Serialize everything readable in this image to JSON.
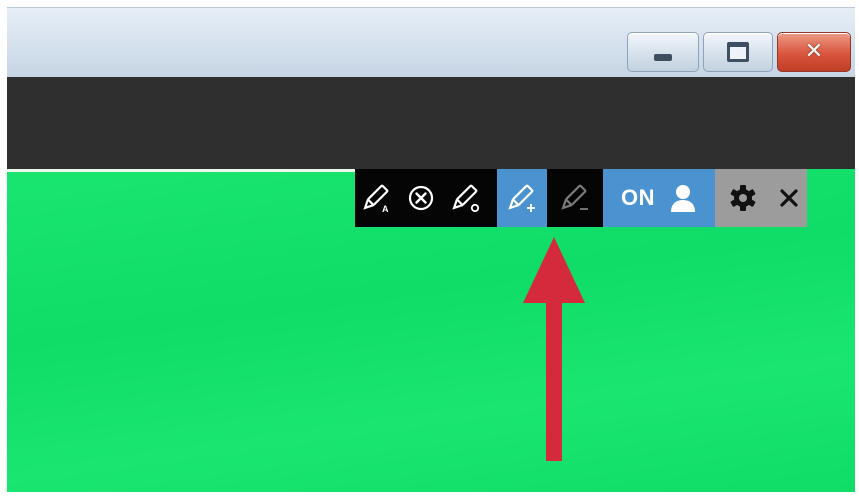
{
  "window": {
    "controls": [
      {
        "name": "minimize",
        "icon": "minimize-icon"
      },
      {
        "name": "maximize",
        "icon": "maximize-icon"
      },
      {
        "name": "close",
        "icon": "close-icon",
        "glyph": "✕"
      }
    ]
  },
  "toolbar": {
    "buttons": [
      {
        "icon": "pencil-a-icon",
        "theme": "dark"
      },
      {
        "icon": "circle-x-icon",
        "theme": "dark"
      },
      {
        "icon": "pencil-circle-icon",
        "theme": "dark"
      },
      {
        "icon": "pencil-plus-icon",
        "theme": "blue",
        "state": "active"
      },
      {
        "icon": "pencil-minus-icon",
        "theme": "dark",
        "state": "disabled"
      },
      {
        "icon": "user-icon",
        "theme": "blue"
      },
      {
        "icon": "gear-icon",
        "theme": "grey"
      },
      {
        "icon": "close-icon",
        "theme": "grey"
      }
    ],
    "toggle_label": "ON"
  },
  "annotation": {
    "icon": "red-arrow-icon",
    "color": "#d42a3c"
  },
  "colors": {
    "background_green": "#10e46b",
    "header_dark": "#2f2f2f",
    "toolbar_dark": "#050505",
    "toolbar_blue": "#4b93d0",
    "toolbar_grey": "#9c9c9c",
    "arrow_red": "#d42a3c"
  }
}
